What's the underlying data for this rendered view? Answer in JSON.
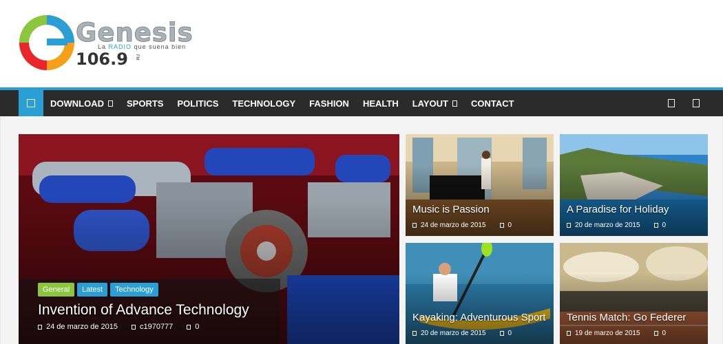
{
  "logo": {
    "name": "Genesis",
    "tagline_prefix": "La",
    "tagline_radio": "RADIO",
    "tagline_suffix": "que suena bien",
    "frequency": "106.9",
    "band": "FM"
  },
  "nav": {
    "items": [
      {
        "label": "DOWNLOAD",
        "dropdown": true
      },
      {
        "label": "SPORTS",
        "dropdown": false
      },
      {
        "label": "POLITICS",
        "dropdown": false
      },
      {
        "label": "TECHNOLOGY",
        "dropdown": false
      },
      {
        "label": "FASHION",
        "dropdown": false
      },
      {
        "label": "HEALTH",
        "dropdown": false
      },
      {
        "label": "LAYOUT",
        "dropdown": true
      },
      {
        "label": "CONTACT",
        "dropdown": false
      }
    ]
  },
  "featured": {
    "tags": [
      "General",
      "Latest",
      "Technology"
    ],
    "title": "Invention of Advance Technology",
    "date": "24 de marzo de 2015",
    "author": "c1970777",
    "comments": "0"
  },
  "cards": [
    {
      "title": "Music is Passion",
      "date": "24 de marzo de 2015",
      "comments": "0"
    },
    {
      "title": "A Paradise for Holiday",
      "date": "20 de marzo de 2015",
      "comments": "0"
    },
    {
      "title": "Kayaking: Adventurous Sport",
      "date": "20 de marzo de 2015",
      "comments": "0"
    },
    {
      "title": "Tennis Match: Go Federer",
      "date": "19 de marzo de 2015",
      "comments": "0"
    }
  ],
  "colors": {
    "accent": "#2a9fd6",
    "nav_bg": "#2b2b2b",
    "tag_general": "#8cc63f"
  }
}
